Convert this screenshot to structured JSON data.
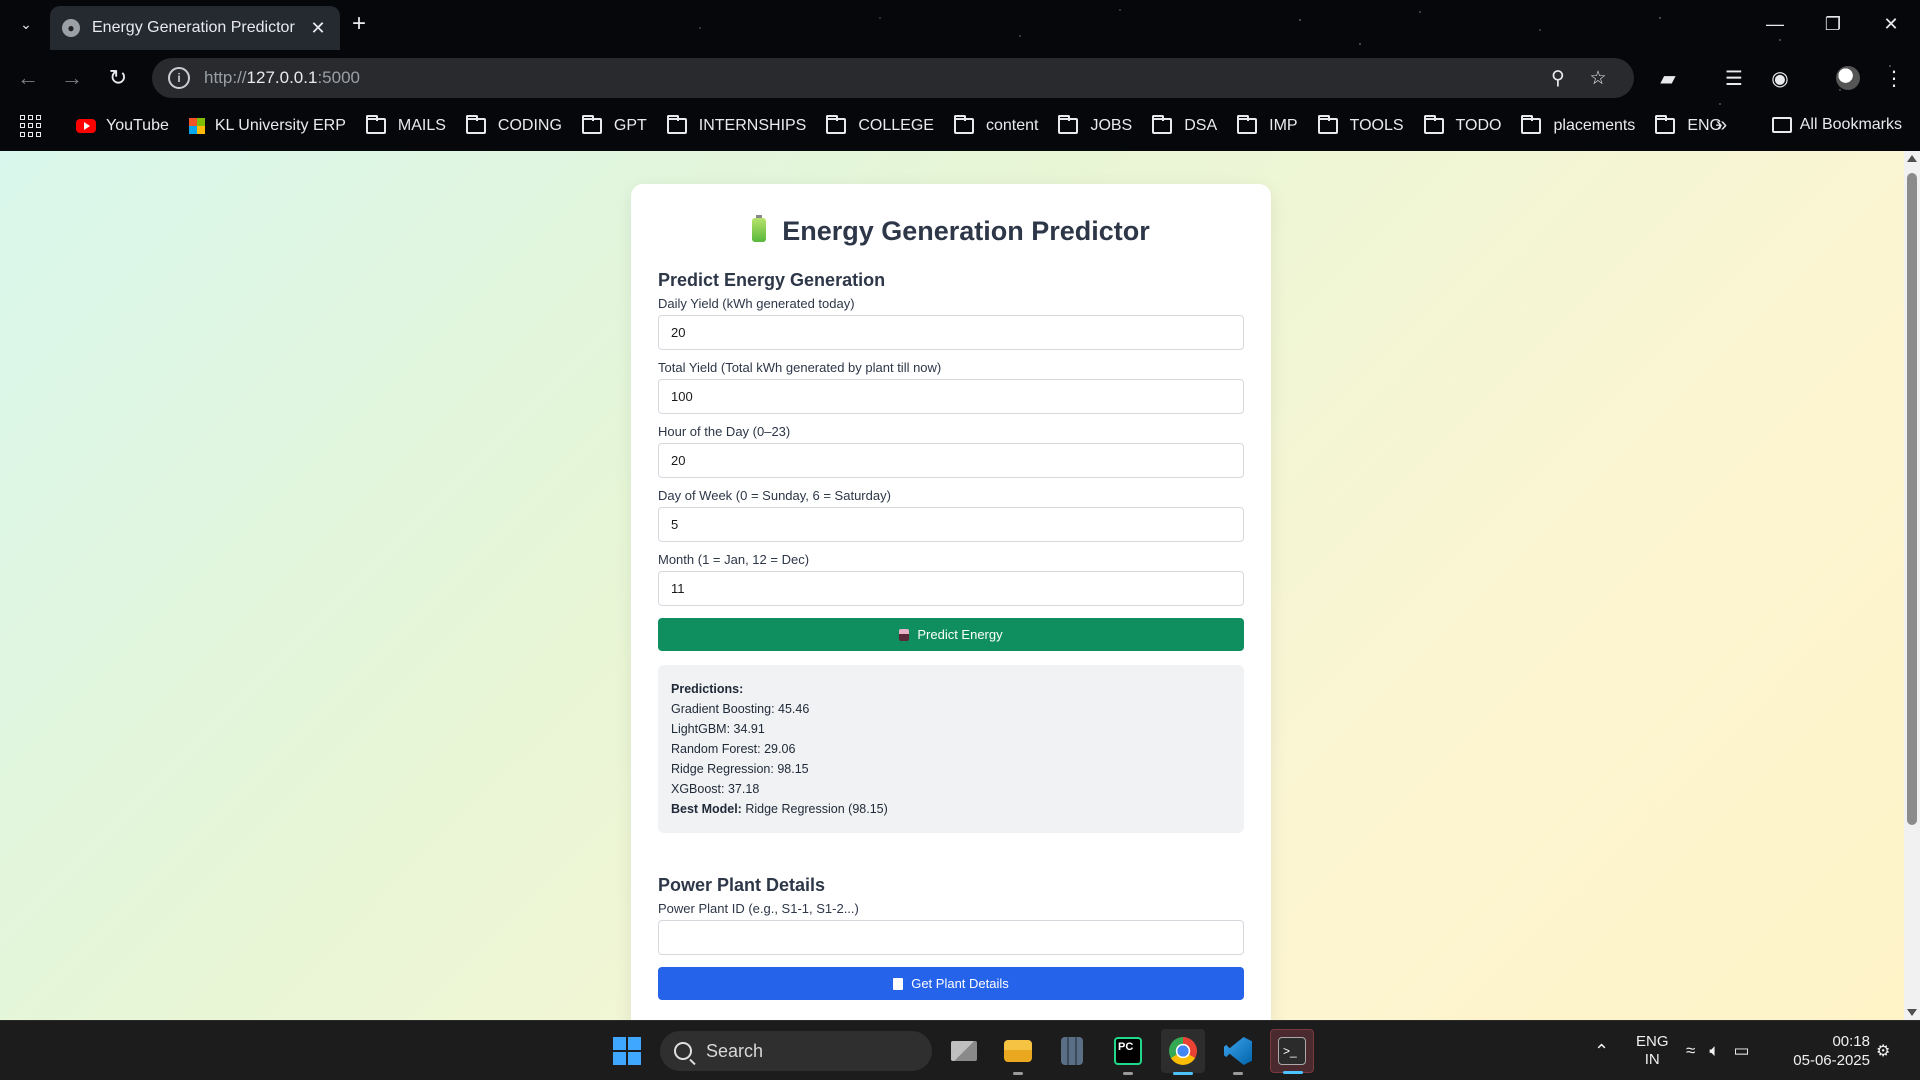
{
  "browser": {
    "tab": {
      "title": "Energy Generation Predictor"
    },
    "url": {
      "scheme": "http://",
      "host": "127.0.0.1",
      "port": ":5000"
    },
    "bookmarks": [
      {
        "label": "YouTube",
        "icon": "youtube-icon"
      },
      {
        "label": "KL University ERP",
        "icon": "kl-erp-icon"
      },
      {
        "label": "MAILS",
        "icon": "folder-icon"
      },
      {
        "label": "CODING",
        "icon": "folder-icon"
      },
      {
        "label": "GPT",
        "icon": "folder-icon"
      },
      {
        "label": "INTERNSHIPS",
        "icon": "folder-icon"
      },
      {
        "label": "COLLEGE",
        "icon": "folder-icon"
      },
      {
        "label": "content",
        "icon": "folder-icon"
      },
      {
        "label": "JOBS",
        "icon": "folder-icon"
      },
      {
        "label": "DSA",
        "icon": "folder-icon"
      },
      {
        "label": "IMP",
        "icon": "folder-icon"
      },
      {
        "label": "TOOLS",
        "icon": "folder-icon"
      },
      {
        "label": "TODO",
        "icon": "folder-icon"
      },
      {
        "label": "placements",
        "icon": "folder-icon"
      },
      {
        "label": "ENG",
        "icon": "folder-icon"
      }
    ],
    "all_bookmarks_label": "All Bookmarks"
  },
  "page": {
    "title": "Energy Generation Predictor",
    "predict_section": {
      "heading": "Predict Energy Generation",
      "fields": [
        {
          "label": "Daily Yield (kWh generated today)",
          "value": "20"
        },
        {
          "label": "Total Yield (Total kWh generated by plant till now)",
          "value": "100"
        },
        {
          "label": "Hour of the Day (0–23)",
          "value": "20"
        },
        {
          "label": "Day of Week (0 = Sunday, 6 = Saturday)",
          "value": "5"
        },
        {
          "label": "Month (1 = Jan, 12 = Dec)",
          "value": "11"
        }
      ],
      "button_label": "Predict Energy"
    },
    "predictions": {
      "heading": "Predictions:",
      "items": [
        {
          "model": "Gradient Boosting",
          "value": "45.46"
        },
        {
          "model": "LightGBM",
          "value": "34.91"
        },
        {
          "model": "Random Forest",
          "value": "29.06"
        },
        {
          "model": "Ridge Regression",
          "value": "98.15"
        },
        {
          "model": "XGBoost",
          "value": "37.18"
        }
      ],
      "best_label": "Best Model:",
      "best_value": "Ridge Regression (98.15)"
    },
    "plant_section": {
      "heading": "Power Plant Details",
      "field_label": "Power Plant ID (e.g., S1-1, S1-2...)",
      "field_value": "",
      "button_label": "Get Plant Details"
    }
  },
  "taskbar": {
    "search_label": "Search",
    "apps": [
      "task-view-icon",
      "file-explorer-icon",
      "calculator-icon",
      "pycharm-icon",
      "chrome-icon",
      "vscode-icon",
      "terminal-icon"
    ],
    "lang_line1": "ENG",
    "lang_line2": "IN",
    "time": "00:18",
    "date": "05-06-2025"
  },
  "colors": {
    "predict_button": "#0f8f5f",
    "plant_button": "#2563eb",
    "accent": "#4cc2ff"
  }
}
